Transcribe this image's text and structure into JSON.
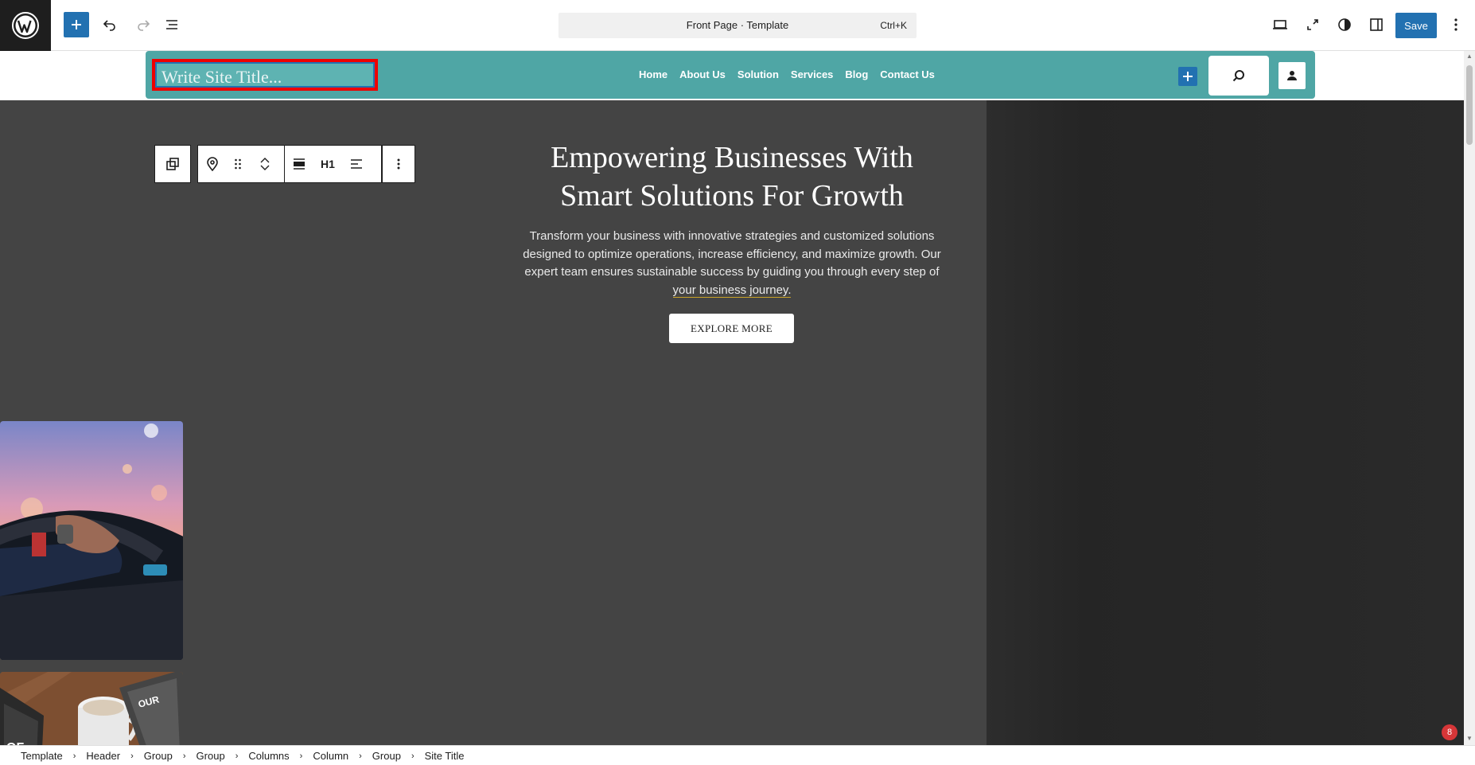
{
  "toolbar": {
    "command_title": "Front Page · Template",
    "command_shortcut": "Ctrl+K",
    "save_label": "Save"
  },
  "header": {
    "site_title_placeholder": "Write Site Title...",
    "nav": [
      "Home",
      "About Us",
      "Solution",
      "Services",
      "Blog",
      "Contact Us"
    ]
  },
  "block_toolbar": {
    "heading_level": "H1"
  },
  "hero": {
    "title_line1": "Empowering Businesses With",
    "title_line2": "Smart Solutions For Growth",
    "text_line1": "Transform your business with innovative strategies and customized solutions",
    "text_line2": "designed to optimize operations, increase efficiency, and maximize growth. Our",
    "text_line3": "expert team ensures sustainable success by guiding you through every step of",
    "text_line4": "your business journey.",
    "button_label": "EXPLORE MORE"
  },
  "breadcrumb": [
    "Template",
    "Header",
    "Group",
    "Group",
    "Columns",
    "Column",
    "Group",
    "Site Title"
  ],
  "notification_count": "8",
  "colors": {
    "accent": "#2271b1",
    "header_bg": "#4fa6a5",
    "hero_bg": "#444444",
    "selection": "#ee0000"
  }
}
